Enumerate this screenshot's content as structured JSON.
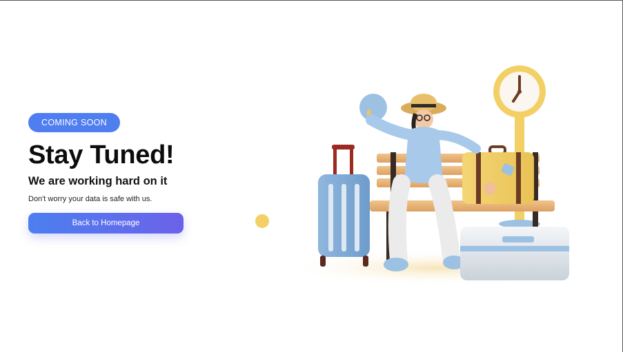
{
  "hero": {
    "badge": "COMING SOON",
    "title": "Stay Tuned!",
    "subtitle": "We are working hard on it",
    "note": "Don't worry your data is safe with us.",
    "cta_label": "Back to Homepage"
  },
  "colors": {
    "accent": "#4f7ef0",
    "accent_end": "#6b62ea",
    "clock_yellow": "#f2d066",
    "suitcase_blue": "#9cc1e2"
  },
  "illustration": {
    "icons": [
      "clock-icon",
      "bench-icon",
      "suitcase-icon",
      "traveler-figure",
      "travel-bag-icon"
    ]
  }
}
